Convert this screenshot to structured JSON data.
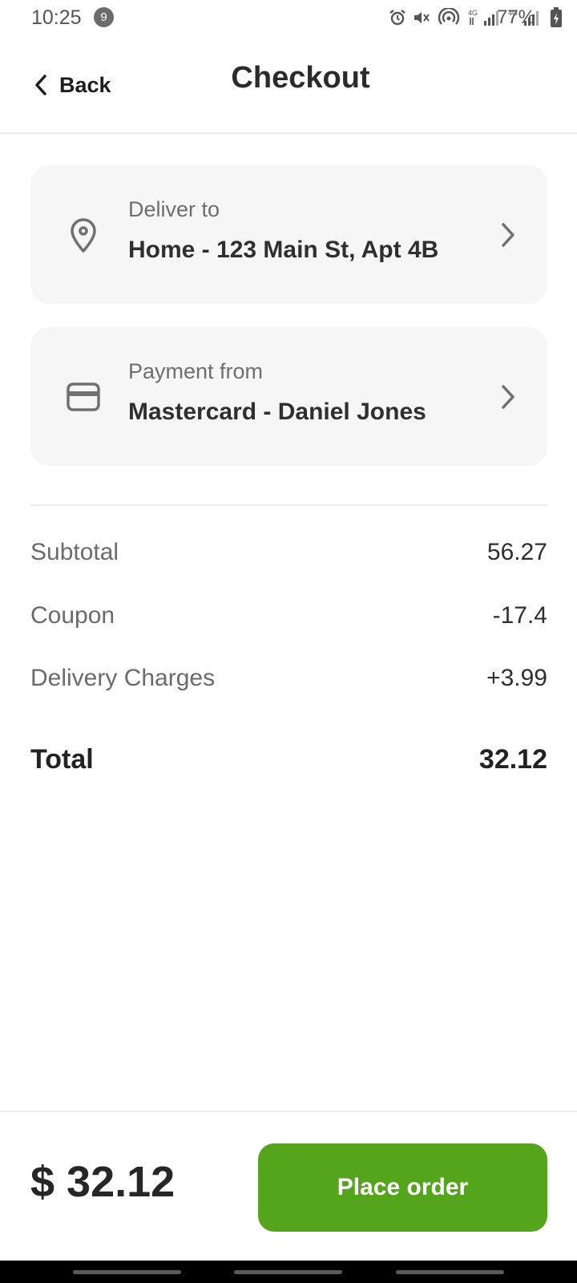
{
  "status_bar": {
    "time": "10:25",
    "notification_count": "9",
    "battery": "77%"
  },
  "header": {
    "back_label": "Back",
    "title": "Checkout"
  },
  "delivery": {
    "label": "Deliver to",
    "value": "Home - 123 Main St, Apt 4B",
    "icon": "location-pin-icon"
  },
  "payment": {
    "label": "Payment from",
    "value": "Mastercard - Daniel Jones",
    "icon": "credit-card-icon"
  },
  "summary": {
    "subtotal_label": "Subtotal",
    "subtotal_value": "56.27",
    "coupon_label": "Coupon",
    "coupon_value": "-17.4",
    "delivery_label": "Delivery Charges",
    "delivery_value": "+3.99",
    "total_label": "Total",
    "total_value": "32.12"
  },
  "footer": {
    "price": "$ 32.12",
    "button_label": "Place order"
  },
  "colors": {
    "accent": "#55a51c",
    "card_bg": "#f6f6f6",
    "text_dark": "#2b2b2b",
    "text_muted": "#6e6e6e"
  }
}
